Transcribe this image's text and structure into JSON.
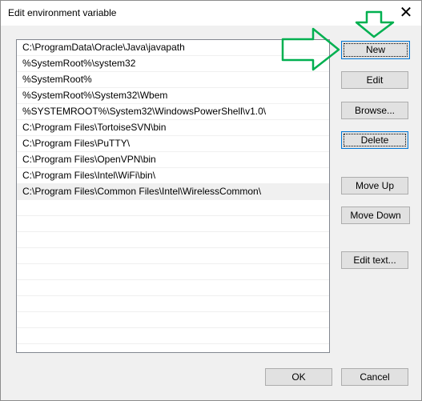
{
  "window": {
    "title": "Edit environment variable",
    "close_glyph": "✕"
  },
  "list": {
    "items": [
      "C:\\ProgramData\\Oracle\\Java\\javapath",
      "%SystemRoot%\\system32",
      "%SystemRoot%",
      "%SystemRoot%\\System32\\Wbem",
      "%SYSTEMROOT%\\System32\\WindowsPowerShell\\v1.0\\",
      "C:\\Program Files\\TortoiseSVN\\bin",
      "C:\\Program Files\\PuTTY\\",
      "C:\\Program Files\\OpenVPN\\bin",
      "C:\\Program Files\\Intel\\WiFi\\bin\\",
      "C:\\Program Files\\Common Files\\Intel\\WirelessCommon\\"
    ],
    "selected_index": 9
  },
  "buttons": {
    "new": "New",
    "edit": "Edit",
    "browse": "Browse...",
    "delete": "Delete",
    "move_up": "Move Up",
    "move_down": "Move Down",
    "edit_text": "Edit text...",
    "ok": "OK",
    "cancel": "Cancel"
  },
  "annotation": {
    "arrow_color": "#00b050"
  }
}
